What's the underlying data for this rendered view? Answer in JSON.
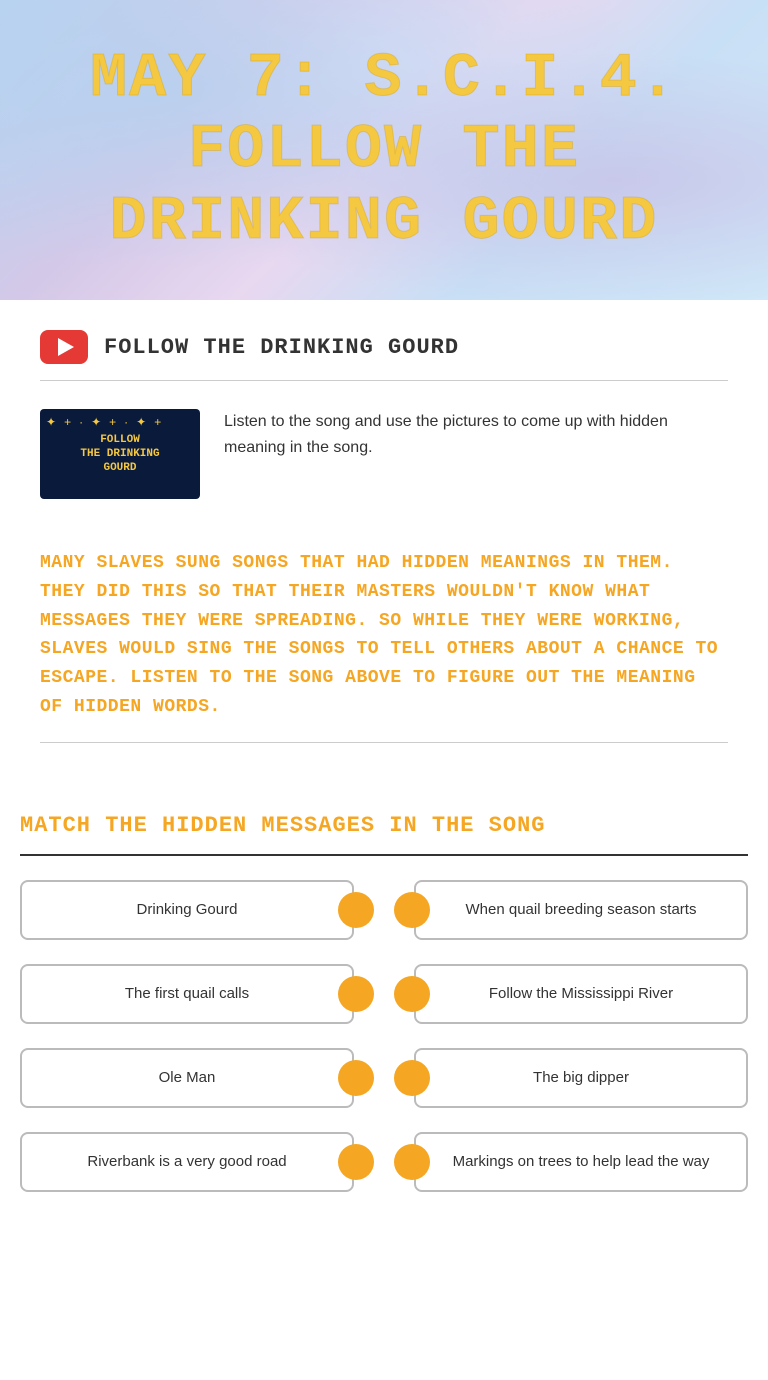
{
  "hero": {
    "title": "MAY 7: S.C.I.4. FOLLOW THE DRINKING GOURD"
  },
  "youtube_section": {
    "icon_label": "youtube-icon",
    "header_label": "FOLLOW THE DRINKING GOURD",
    "video": {
      "thumb_lines": [
        "FOLLOW",
        "THE DRINKING",
        "GOURD"
      ],
      "description": "Listen to the song and use the pictures to come up with hidden meaning in the song."
    }
  },
  "orange_paragraph": "MANY SLAVES SUNG SONGS THAT HAD HIDDEN MEANINGS IN THEM. THEY DID THIS SO THAT THEIR MASTERS WOULDN'T KNOW WHAT MESSAGES THEY WERE SPREADING. SO WHILE THEY WERE WORKING, SLAVES WOULD SING THE SONGS TO TELL OTHERS ABOUT A CHANCE TO ESCAPE. LISTEN TO THE SONG ABOVE TO FIGURE OUT THE MEANING OF HIDDEN WORDS.",
  "match_section": {
    "title": "MATCH THE HIDDEN MESSAGES IN THE SONG",
    "pairs": [
      {
        "left": "Drinking Gourd",
        "right": "When quail breeding season starts"
      },
      {
        "left": "The first quail calls",
        "right": "Follow the Mississippi River"
      },
      {
        "left": "Ole Man",
        "right": "The big dipper"
      },
      {
        "left": "Riverbank is a very good road",
        "right": "Markings on trees to help lead the way"
      }
    ]
  }
}
